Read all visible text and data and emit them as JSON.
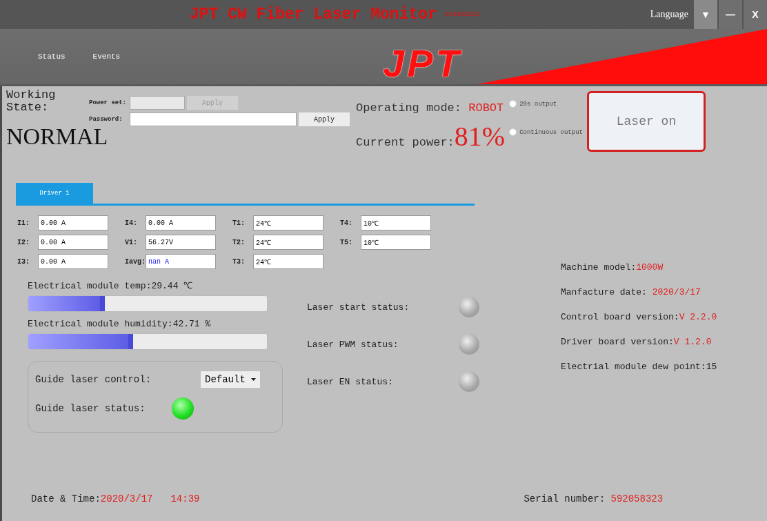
{
  "window": {
    "title": "JPT CW Fiber Laser Monitor",
    "subtitle": "592058323",
    "language": "Language",
    "menu_glyph": "▼",
    "minimize_glyph": "—",
    "close_glyph": "X"
  },
  "nav": {
    "items": [
      {
        "label": "Status"
      },
      {
        "label": "Events"
      }
    ],
    "logo": "JPT"
  },
  "working_state": {
    "label": "Working State:",
    "value": "NORMAL"
  },
  "power_set": {
    "label": "Power set:",
    "button": "Apply",
    "disabled": true
  },
  "password": {
    "label": "Password:",
    "button": "Apply",
    "disabled": false
  },
  "operating_mode": {
    "label": "Operating mode: ",
    "value": "ROBOT"
  },
  "current_power": {
    "label": "Current power:",
    "value": "81%"
  },
  "output_modes": [
    {
      "label": "20s output",
      "selected": false
    },
    {
      "label": "Continuous output",
      "selected": false
    }
  ],
  "laser_button": "Laser on",
  "tabs": [
    {
      "label": "Driver 1",
      "selected": true
    }
  ],
  "fields": [
    {
      "label": "I1:",
      "value": "0.00 A"
    },
    {
      "label": "I4:",
      "value": "0.00 A"
    },
    {
      "label": "T1:",
      "value": "24℃"
    },
    {
      "label": "T4:",
      "value": "10℃"
    },
    {
      "label": "I2:",
      "value": "0.00 A"
    },
    {
      "label": "V1:",
      "value": "56.27V"
    },
    {
      "label": "T2:",
      "value": "24℃"
    },
    {
      "label": "T5:",
      "value": "10℃"
    },
    {
      "label": "I3:",
      "value": "0.00 A"
    },
    {
      "label": "Iavg:",
      "value": "nan A",
      "color": "#2222ee"
    },
    {
      "label": "T3:",
      "value": "24℃"
    }
  ],
  "meters": [
    {
      "label": "Electrical module temp:29.44 ℃",
      "level": 0.32
    },
    {
      "label": "Electrical module humidity:42.71 %",
      "level": 0.44
    }
  ],
  "guide": {
    "control_label": "Guide laser control:",
    "control_value": "Default",
    "status_label": "Guide laser status:",
    "status_on": true
  },
  "lamps": [
    {
      "label": "Laser start status:",
      "on": false
    },
    {
      "label": "Laser PWM status:",
      "on": false
    },
    {
      "label": "Laser EN status:",
      "on": false
    }
  ],
  "info": [
    {
      "label": "Machine model:",
      "value": "1000W"
    },
    {
      "label": "Manfacture date: ",
      "value": "2020/3/17"
    },
    {
      "label": "Control board version:",
      "value": "V 2.2.0"
    },
    {
      "label": "Driver board version:",
      "value": "V 1.2.0"
    },
    {
      "label": "Electrial module dew point:15"
    }
  ],
  "footer": {
    "label": "Date & Time:",
    "date": "2020/3/17",
    "time": "14:39",
    "serial_label": "Serial number: ",
    "serial": "592058323"
  }
}
